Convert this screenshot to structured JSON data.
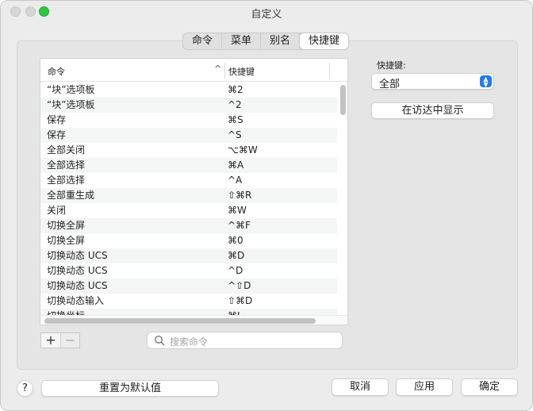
{
  "window": {
    "title": "自定义"
  },
  "tabs": [
    {
      "label": "命令",
      "active": false
    },
    {
      "label": "菜单",
      "active": false
    },
    {
      "label": "别名",
      "active": false
    },
    {
      "label": "快捷键",
      "active": true
    }
  ],
  "table": {
    "columns": {
      "command": "命令",
      "shortcut": "快捷键",
      "sort_indicator": "^"
    },
    "rows": [
      {
        "command": "“块”选项板",
        "shortcut": "⌘2"
      },
      {
        "command": "“块”选项板",
        "shortcut": "^2"
      },
      {
        "command": "保存",
        "shortcut": "⌘S"
      },
      {
        "command": "保存",
        "shortcut": "^S"
      },
      {
        "command": "全部关闭",
        "shortcut": "⌥⌘W"
      },
      {
        "command": "全部选择",
        "shortcut": "⌘A"
      },
      {
        "command": "全部选择",
        "shortcut": "^A"
      },
      {
        "command": "全部重生成",
        "shortcut": "⇧⌘R"
      },
      {
        "command": "关闭",
        "shortcut": "⌘W"
      },
      {
        "command": "切换全屏",
        "shortcut": "^⌘F"
      },
      {
        "command": "切换全屏",
        "shortcut": "⌘0"
      },
      {
        "command": "切换动态 UCS",
        "shortcut": "⌘D"
      },
      {
        "command": "切换动态 UCS",
        "shortcut": "^D"
      },
      {
        "command": "切换动态 UCS",
        "shortcut": "^⇧D"
      },
      {
        "command": "切换动态输入",
        "shortcut": "⇧⌘D"
      },
      {
        "command": "切换坐标",
        "shortcut": "⌘L"
      }
    ]
  },
  "controls": {
    "add_label": "+",
    "remove_label": "−",
    "search_placeholder": "搜索命令"
  },
  "right_panel": {
    "filter_label": "快捷键:",
    "filter_value": "全部",
    "show_in_finder": "在访达中显示"
  },
  "footer": {
    "help": "?",
    "reset": "重置为默认值",
    "cancel": "取消",
    "apply": "应用",
    "ok": "确定"
  }
}
